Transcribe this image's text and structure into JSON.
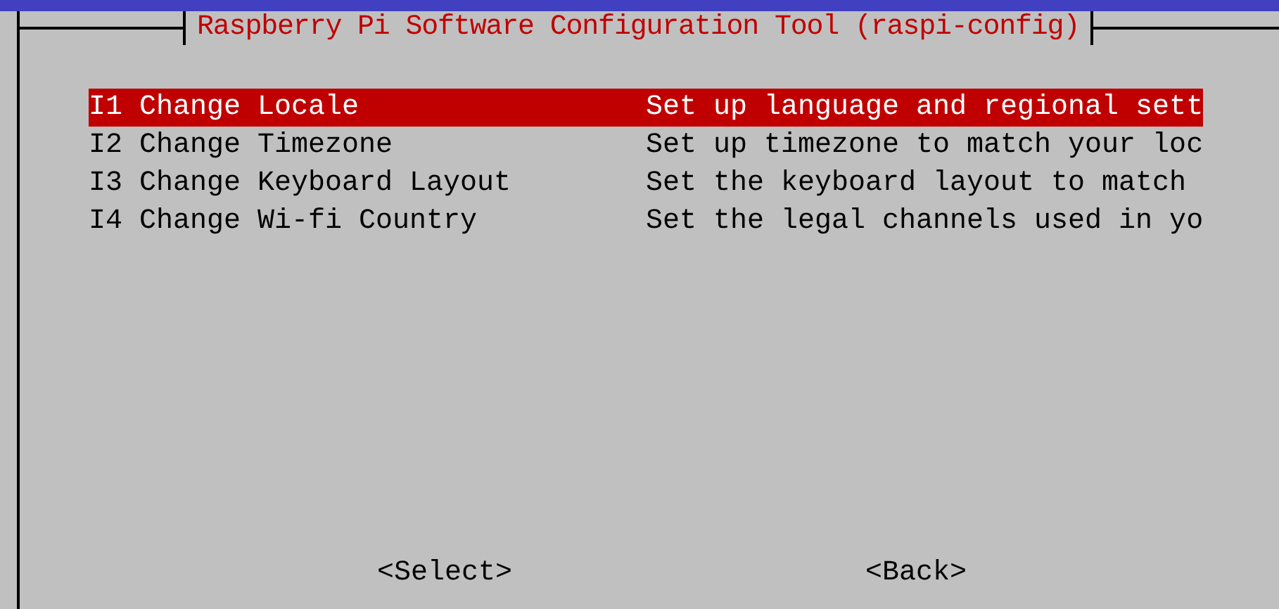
{
  "dialog": {
    "title": "Raspberry Pi Software Configuration Tool (raspi-config)"
  },
  "menu_items": [
    {
      "label": "I1 Change Locale",
      "description": "Set up language and regional sett",
      "selected": true
    },
    {
      "label": "I2 Change Timezone",
      "description": "Set up timezone to match your loc",
      "selected": false
    },
    {
      "label": "I3 Change Keyboard Layout",
      "description": "Set the keyboard layout to match",
      "selected": false
    },
    {
      "label": "I4 Change Wi-fi Country",
      "description": "Set the legal channels used in yo",
      "selected": false
    }
  ],
  "buttons": [
    {
      "label": "<Select>"
    },
    {
      "label": "<Back>"
    }
  ]
}
